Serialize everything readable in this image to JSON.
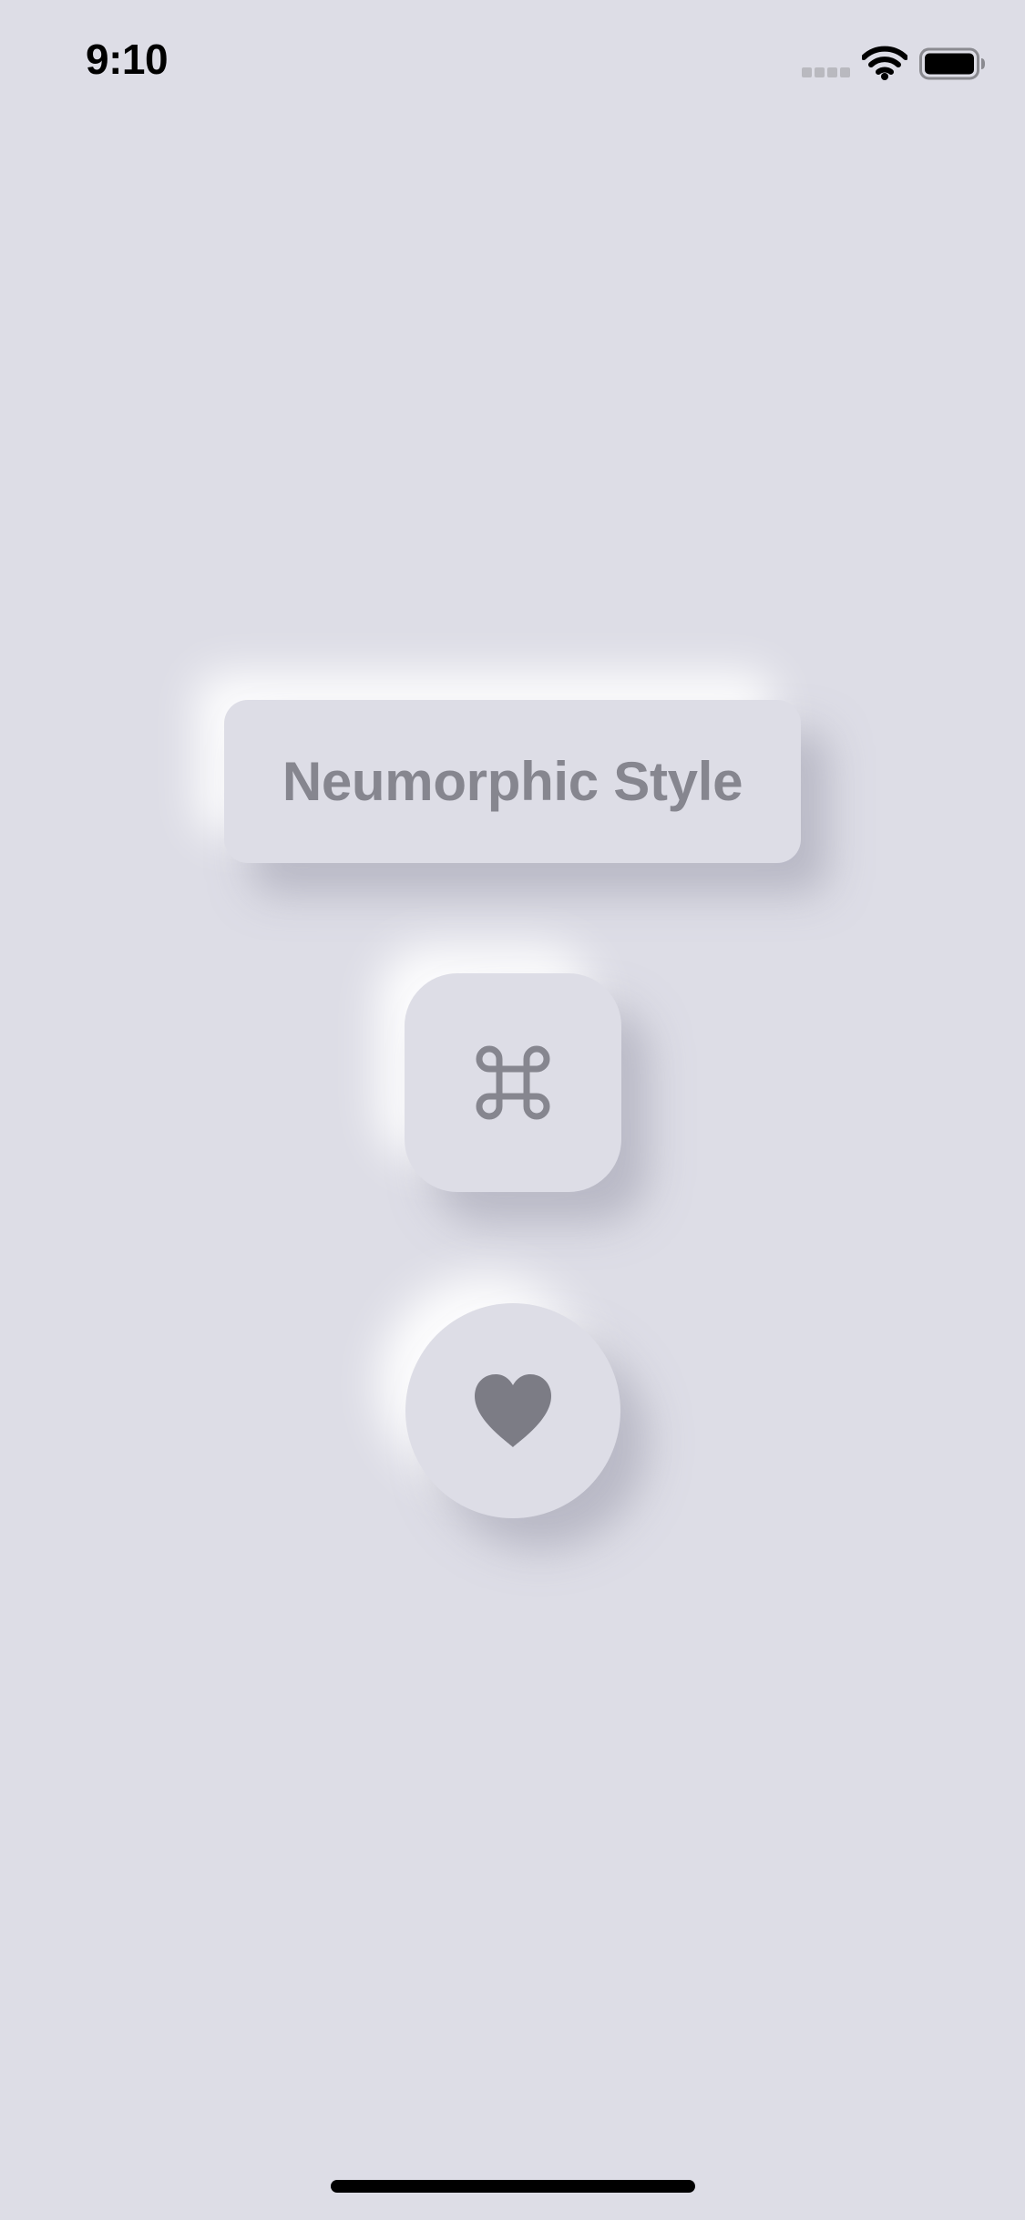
{
  "status_bar": {
    "time": "9:10",
    "signal_icon": "cellular-signal-icon",
    "wifi_icon": "wifi-icon",
    "battery_icon": "battery-icon"
  },
  "buttons": {
    "text_button_label": "Neumorphic Style",
    "command_button_icon": "command-icon",
    "heart_button_icon": "heart-icon"
  },
  "colors": {
    "background": "#dddde6",
    "foreground": "#86868f",
    "heart": "#7c7c85"
  }
}
